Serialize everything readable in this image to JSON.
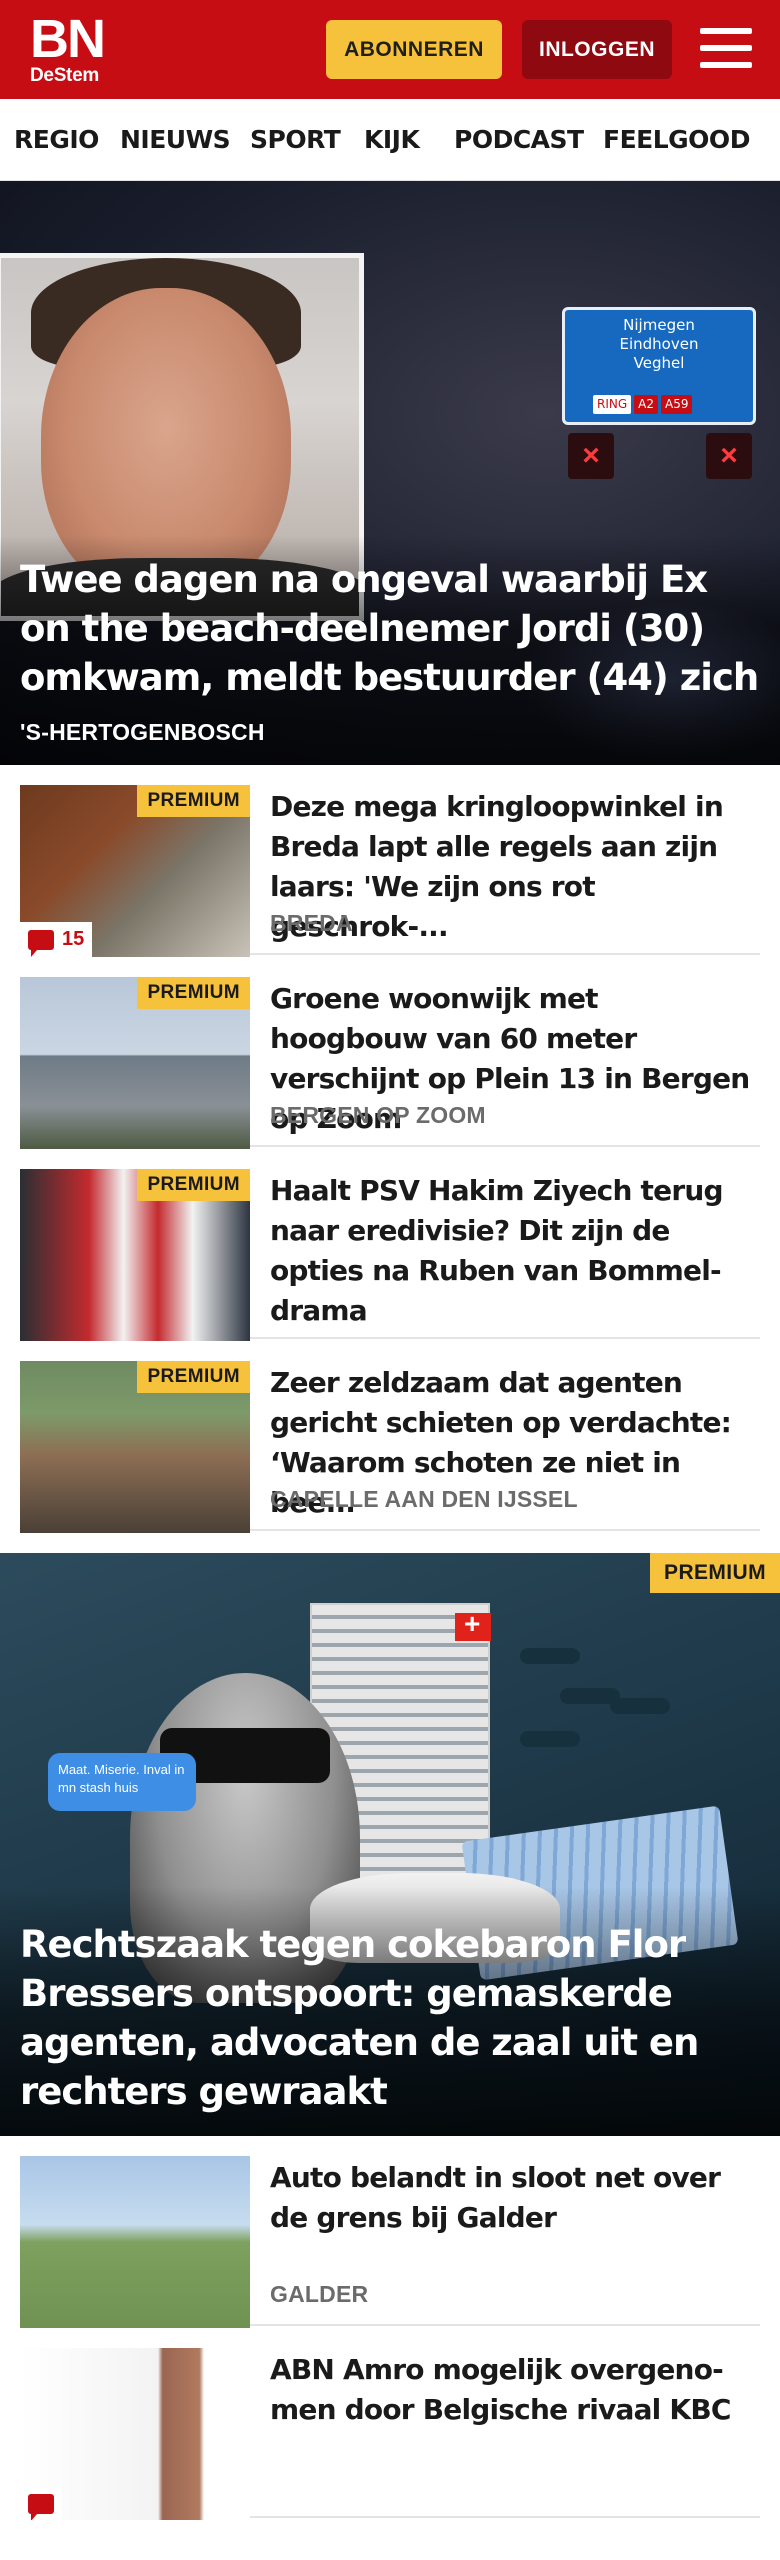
{
  "header": {
    "logo_text": "BN",
    "logo_sub": "DeStem",
    "subscribe_label": "ABONNEREN",
    "login_label": "INLOGGEN",
    "menu_icon": "hamburger-menu-icon"
  },
  "nav": {
    "items": [
      "REGIO",
      "NIEUWS",
      "SPORT",
      "KIJK",
      "PODCAST",
      "FEELGOOD"
    ]
  },
  "hero": {
    "title": "Twee dagen na ongeval waarbij Ex on the beach-deelnemer Jordi (30) omkwam, meldt bestuurder (44) zich",
    "location": "'S-HERTOGENBOSCH",
    "sign_lines": [
      "Nijmegen",
      "Eindhoven",
      "Veghel"
    ],
    "sign_tags": [
      "RING",
      "A2",
      "A59"
    ]
  },
  "premium_label": "PREMIUM",
  "articles": [
    {
      "title": "Deze mega kringloopwinkel in Breda lapt alle regels aan zijn laars: 'We zijn ons rot geschrok-...",
      "location": "BREDA",
      "premium": true,
      "comments": "15"
    },
    {
      "title": "Groene woonwijk met hoogbouw van 60 meter verschijnt op Plein 13 in Bergen op Zoom",
      "location": "BERGEN OP ZOOM",
      "premium": true
    },
    {
      "title": "Haalt PSV Hakim Ziyech terug naar eredivisie? Dit zijn de opties na Ruben van Bommel-drama",
      "location": "",
      "premium": true
    },
    {
      "title": "Zeer zeldzaam dat agenten gericht schieten op verdachte: ‘Waarom schoten ze niet in bee...",
      "location": "CAPELLE AAN DEN IJSSEL",
      "premium": true
    }
  ],
  "feature": {
    "title": "Rechtszaak tegen cokebaron Flor Bressers ontspoort: gemaskerde agenten, advocaten de zaal uit en rechters gewraakt",
    "chat_text": "Maat. Miserie. Inval in mn stash huis",
    "premium": true
  },
  "articles_bottom": [
    {
      "title": "Auto belandt in sloot net over de grens bij Galder",
      "location": "GALDER"
    },
    {
      "title": "ABN Amro mogelijk overgeno-men door Belgische rivaal KBC",
      "location": ""
    }
  ],
  "colors": {
    "brand_red": "#c70d14",
    "premium_yellow": "#f6c23b",
    "login_dark_red": "#8e0910"
  }
}
